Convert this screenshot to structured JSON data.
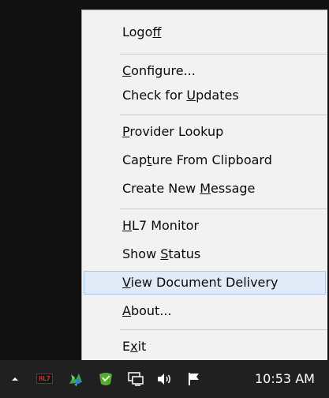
{
  "menu": {
    "items": [
      {
        "pre": "Logo",
        "key": "f",
        "post": "f"
      },
      {
        "pre": "",
        "key": "C",
        "post": "onfigure..."
      },
      {
        "pre": "Check for ",
        "key": "U",
        "post": "pdates"
      },
      {
        "pre": "",
        "key": "P",
        "post": "rovider Lookup"
      },
      {
        "pre": "Cap",
        "key": "t",
        "post": "ure From Clipboard"
      },
      {
        "pre": "Create New ",
        "key": "M",
        "post": "essage"
      },
      {
        "pre": "",
        "key": "H",
        "post": "L7 Monitor"
      },
      {
        "pre": "Show ",
        "key": "S",
        "post": "tatus"
      },
      {
        "pre": "",
        "key": "V",
        "post": "iew Document Delivery"
      },
      {
        "pre": "",
        "key": "A",
        "post": "bout..."
      },
      {
        "pre": "E",
        "key": "x",
        "post": "it"
      }
    ],
    "highlighted": "View Document Delivery"
  },
  "taskbar": {
    "tray_icons": [
      "show-hidden-icons-chevron-icon",
      "hl7-app-icon",
      "green-puzzle-app-icon",
      "green-shield-app-icon",
      "network-icon",
      "speaker-volume-icon",
      "action-center-flag-icon"
    ],
    "hl7_badge": "HL7",
    "clock": "10:53 AM"
  }
}
